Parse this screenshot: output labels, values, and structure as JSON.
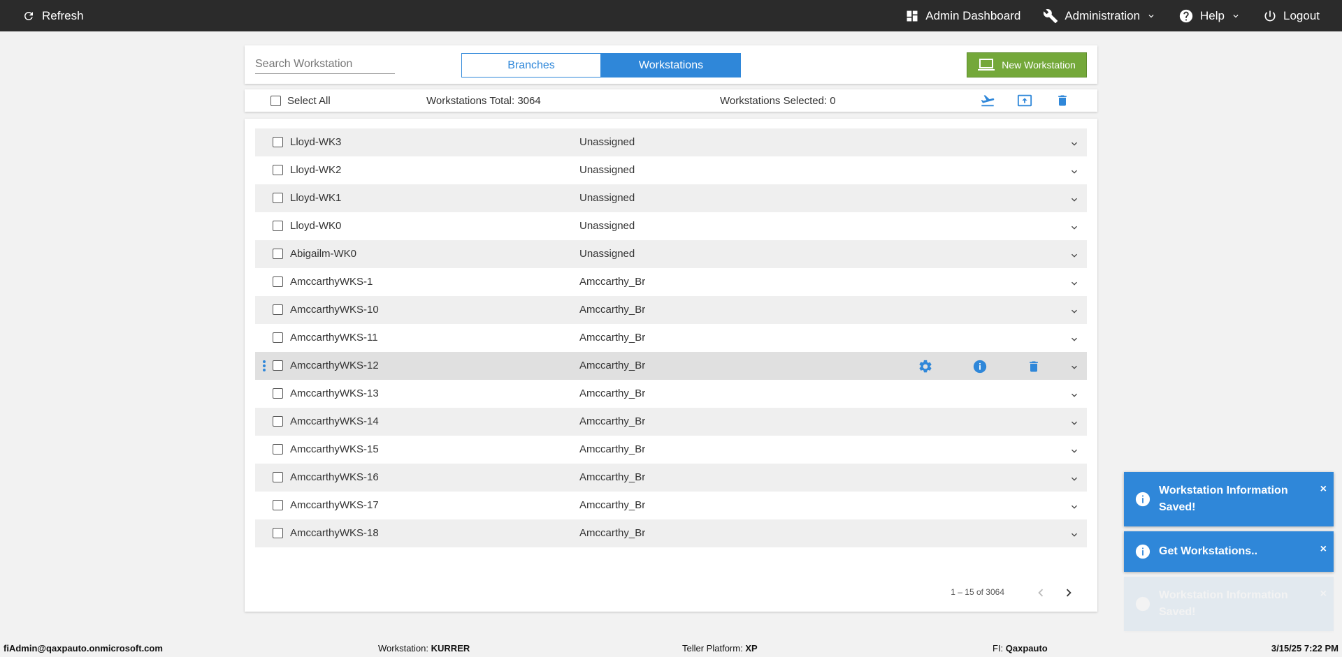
{
  "topbar": {
    "refresh_label": "Refresh",
    "admin_dashboard_label": "Admin Dashboard",
    "administration_label": "Administration",
    "help_label": "Help",
    "logout_label": "Logout"
  },
  "header": {
    "search_placeholder": "Search Workstation",
    "tab_branches": "Branches",
    "tab_workstations": "Workstations",
    "active_tab": "Workstations",
    "new_workstation_label": "New Workstation"
  },
  "toolbar": {
    "select_all_label": "Select All",
    "total_label": "Workstations Total: 3064",
    "selected_label": "Workstations Selected: 0"
  },
  "rows": [
    {
      "name": "Lloyd-WK3",
      "branch": "Unassigned"
    },
    {
      "name": "Lloyd-WK2",
      "branch": "Unassigned"
    },
    {
      "name": "Lloyd-WK1",
      "branch": "Unassigned"
    },
    {
      "name": "Lloyd-WK0",
      "branch": "Unassigned"
    },
    {
      "name": "Abigailm-WK0",
      "branch": "Unassigned"
    },
    {
      "name": "AmccarthyWKS-1",
      "branch": "Amccarthy_Br"
    },
    {
      "name": "AmccarthyWKS-10",
      "branch": "Amccarthy_Br"
    },
    {
      "name": "AmccarthyWKS-11",
      "branch": "Amccarthy_Br"
    },
    {
      "name": "AmccarthyWKS-12",
      "branch": "Amccarthy_Br"
    },
    {
      "name": "AmccarthyWKS-13",
      "branch": "Amccarthy_Br"
    },
    {
      "name": "AmccarthyWKS-14",
      "branch": "Amccarthy_Br"
    },
    {
      "name": "AmccarthyWKS-15",
      "branch": "Amccarthy_Br"
    },
    {
      "name": "AmccarthyWKS-16",
      "branch": "Amccarthy_Br"
    },
    {
      "name": "AmccarthyWKS-17",
      "branch": "Amccarthy_Br"
    },
    {
      "name": "AmccarthyWKS-18",
      "branch": "Amccarthy_Br"
    }
  ],
  "hovered_row": "AmccarthyWKS-12",
  "pager": {
    "range_label": "1 – 15 of 3064"
  },
  "toasts": [
    {
      "message": "Workstation Information Saved!",
      "close": "×"
    },
    {
      "message": "Get Workstations..",
      "close": "×"
    },
    {
      "message": "Workstation Information Saved!",
      "close": "×"
    }
  ],
  "statusbar": {
    "user": "fiAdmin@qaxpauto.onmicrosoft.com",
    "workstation_label": "Workstation:",
    "workstation_value": "KURRER",
    "platform_label": "Teller Platform:",
    "platform_value": "XP",
    "fi_label": "FI:",
    "fi_value": "Qaxpauto",
    "datetime": "3/15/25 7:22 PM"
  },
  "colors": {
    "accent": "#2f87d9",
    "topbar": "#2b2b2b",
    "new_button": "#74a83a"
  }
}
